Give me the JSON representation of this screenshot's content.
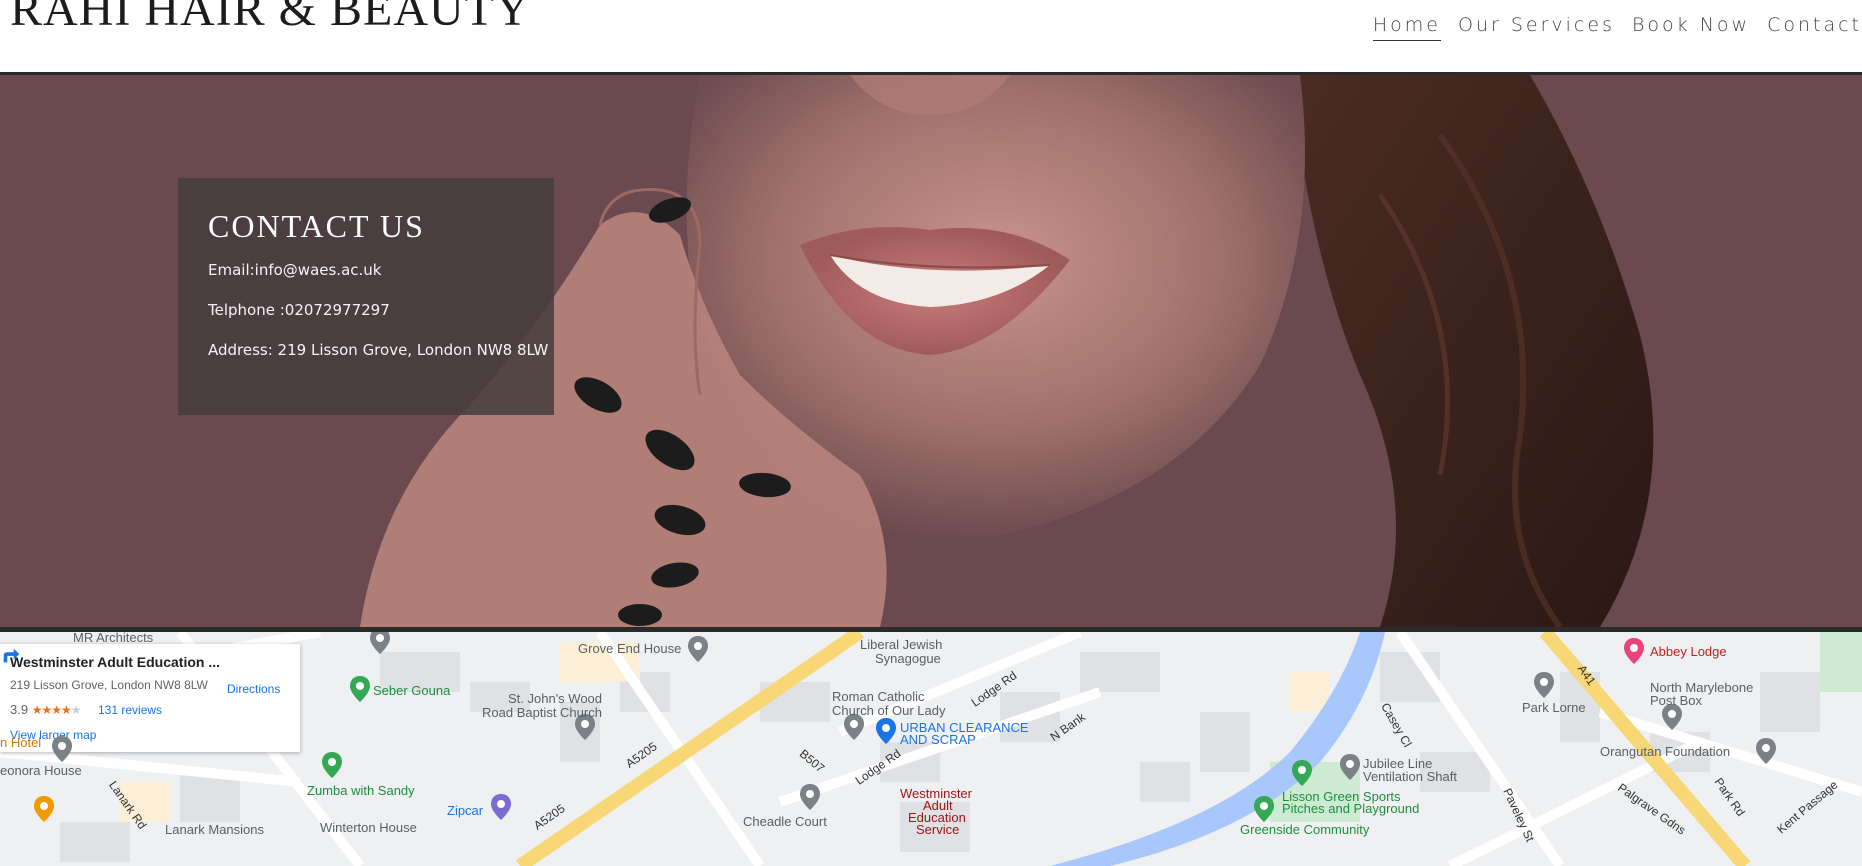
{
  "header": {
    "logo": "RAHI HAIR & BEAUTY",
    "nav": [
      "Home",
      "Our Services",
      "Book Now",
      "Contact"
    ]
  },
  "contact": {
    "title": "CONTACT US",
    "email": "Email:info@waes.ac.uk",
    "phone": "Telphone :02072977297",
    "address": "Address: 219 Lisson Grove, London NW8 8LW"
  },
  "map_card": {
    "name": "Westminster Adult Education ...",
    "address": "219 Lisson Grove, London NW8 8LW",
    "rating": "3.9",
    "stars": 3.9,
    "reviews": "131 reviews",
    "directions": "Directions",
    "larger_map": "View larger map"
  },
  "map_labels": {
    "mr_architects": "MR Architects",
    "grove_end_house": "Grove End House",
    "liberal_jewish_1": "Liberal Jewish",
    "liberal_jewish_2": "Synagogue",
    "seber_gouna": "Seber Gouna",
    "st_johns_1": "St. John's Wood",
    "st_johns_2": "Road Baptist Church",
    "roman_catholic_1": "Roman Catholic",
    "roman_catholic_2": "Church of Our Lady",
    "urban_clearance_1": "URBAN CLEARANCE",
    "urban_clearance_2": "AND SCRAP",
    "abbey_lodge": "Abbey Lodge",
    "park_lorne": "Park Lorne",
    "north_marylebone_1": "North Marylebone",
    "north_marylebone_2": "Post Box",
    "orangutan": "Orangutan Foundation",
    "jubilee_1": "Jubilee Line",
    "jubilee_2": "Ventilation Shaft",
    "lisson_green_1": "Lisson Green Sports",
    "lisson_green_2": "Pitches and Playground",
    "greenside": "Greenside Community",
    "westminster_1": "Westminster",
    "westminster_2": "Adult",
    "westminster_3": "Education",
    "westminster_4": "Service",
    "zumba": "Zumba with Sandy",
    "zipcar": "Zipcar",
    "winterton": "Winterton House",
    "cheadle": "Cheadle Court",
    "eleonora": "eonora House",
    "n_hotel": "n Hotel",
    "lanark_rd": "Lanark Rd",
    "lanark_mansions": "Lanark Mansions",
    "a5205_a": "A5205",
    "a5205_b": "A5205",
    "b507": "B507",
    "lodge_rd_1": "Lodge Rd",
    "lodge_rd_2": "Lodge Rd",
    "n_bank": "N Bank",
    "casey_cl": "Casey Cl",
    "a41": "A41",
    "park_rd": "Park Rd",
    "paveley_st": "Paveley St",
    "palgrave_gdns": "Palgrave Gdns",
    "kent_passage": "Kent Passage"
  }
}
